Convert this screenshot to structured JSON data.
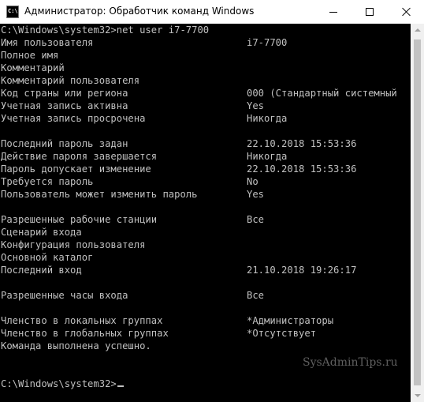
{
  "window": {
    "title": "Администратор: Обработчик команд Windows",
    "icon": "cmd-icon",
    "icon_text": "C:\\."
  },
  "console": {
    "command_line": "C:\\Windows\\system32>net user i7-7700",
    "rows": [
      {
        "label": "Имя пользователя",
        "value": "i7-7700"
      },
      {
        "label": "Полное имя",
        "value": ""
      },
      {
        "label": "Комментарий",
        "value": ""
      },
      {
        "label": "Комментарий пользователя",
        "value": ""
      },
      {
        "label": "Код страны или региона",
        "value": "000 (Стандартный системный"
      },
      {
        "label": "Учетная запись активна",
        "value": "Yes"
      },
      {
        "label": "Учетная запись просрочена",
        "value": "Никогда"
      },
      {
        "label": "",
        "value": ""
      },
      {
        "label": "Последний пароль задан",
        "value": "22.10.2018 15:53:36"
      },
      {
        "label": "Действие пароля завершается",
        "value": "Никогда"
      },
      {
        "label": "Пароль допускает изменение",
        "value": "22.10.2018 15:53:36"
      },
      {
        "label": "Требуется пароль",
        "value": "No"
      },
      {
        "label": "Пользователь может изменить пароль",
        "value": "Yes"
      },
      {
        "label": "",
        "value": ""
      },
      {
        "label": "Разрешенные рабочие станции",
        "value": "Все"
      },
      {
        "label": "Сценарий входа",
        "value": ""
      },
      {
        "label": "Конфигурация пользователя",
        "value": ""
      },
      {
        "label": "Основной каталог",
        "value": ""
      },
      {
        "label": "Последний вход",
        "value": "21.10.2018 19:26:17"
      },
      {
        "label": "",
        "value": ""
      },
      {
        "label": "Разрешенные часы входа",
        "value": "Все"
      },
      {
        "label": "",
        "value": ""
      },
      {
        "label": "Членство в локальных группах",
        "value": "*Администраторы"
      },
      {
        "label": "Членство в глобальных группах",
        "value": "*Отсутствует"
      },
      {
        "label": "Команда выполнена успешно.",
        "value": ""
      },
      {
        "label": "",
        "value": ""
      },
      {
        "label": "",
        "value": ""
      }
    ],
    "prompt": "C:\\Windows\\system32>"
  },
  "watermark": "SysAdminTips.ru",
  "colors": {
    "background": "#000000",
    "text": "#c0c0c0",
    "titlebar": "#ffffff",
    "scrollbar_track": "#f0f0f0",
    "scrollbar_thumb": "#c2c2c2"
  }
}
